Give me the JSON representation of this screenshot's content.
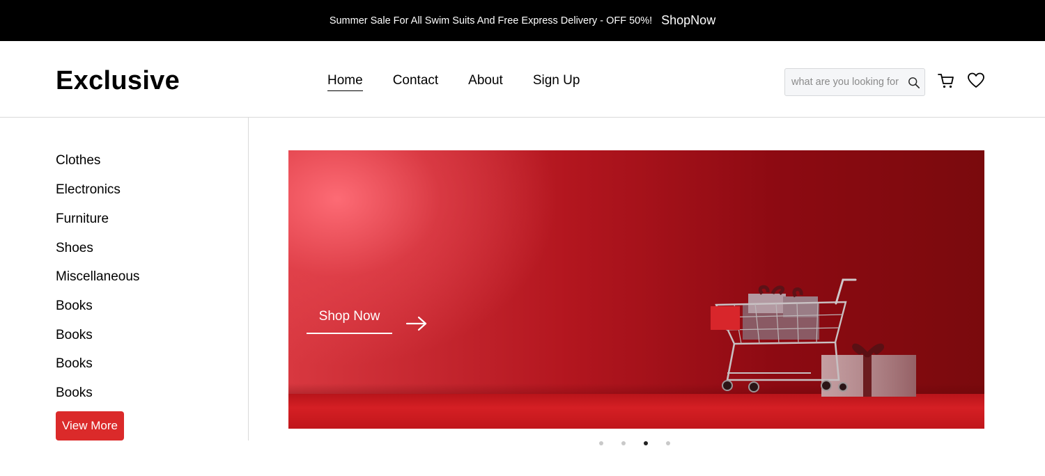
{
  "topbar": {
    "promo_text": "Summer Sale For All Swim Suits And Free Express Delivery - OFF 50%!",
    "shop_link": "ShopNow"
  },
  "header": {
    "logo": "Exclusive",
    "nav": [
      "Home",
      "Contact",
      "About",
      "Sign Up"
    ],
    "active_nav": "Home",
    "search": {
      "placeholder": "what are you looking for",
      "value": ""
    },
    "icons": [
      "search-icon",
      "cart-icon",
      "heart-icon"
    ]
  },
  "sidebar": {
    "categories": [
      "Clothes",
      "Electronics",
      "Furniture",
      "Shoes",
      "Miscellaneous",
      "Books",
      "Books",
      "Books",
      "Books"
    ],
    "view_more": "View More"
  },
  "hero": {
    "cta": "Shop Now",
    "arrow_icon": "arrow-right-icon",
    "slides_count": 4,
    "active_slide": 3
  },
  "colors": {
    "accent": "#db2a2a",
    "topbar_bg": "#000000",
    "hero_red": "#b3161f"
  }
}
